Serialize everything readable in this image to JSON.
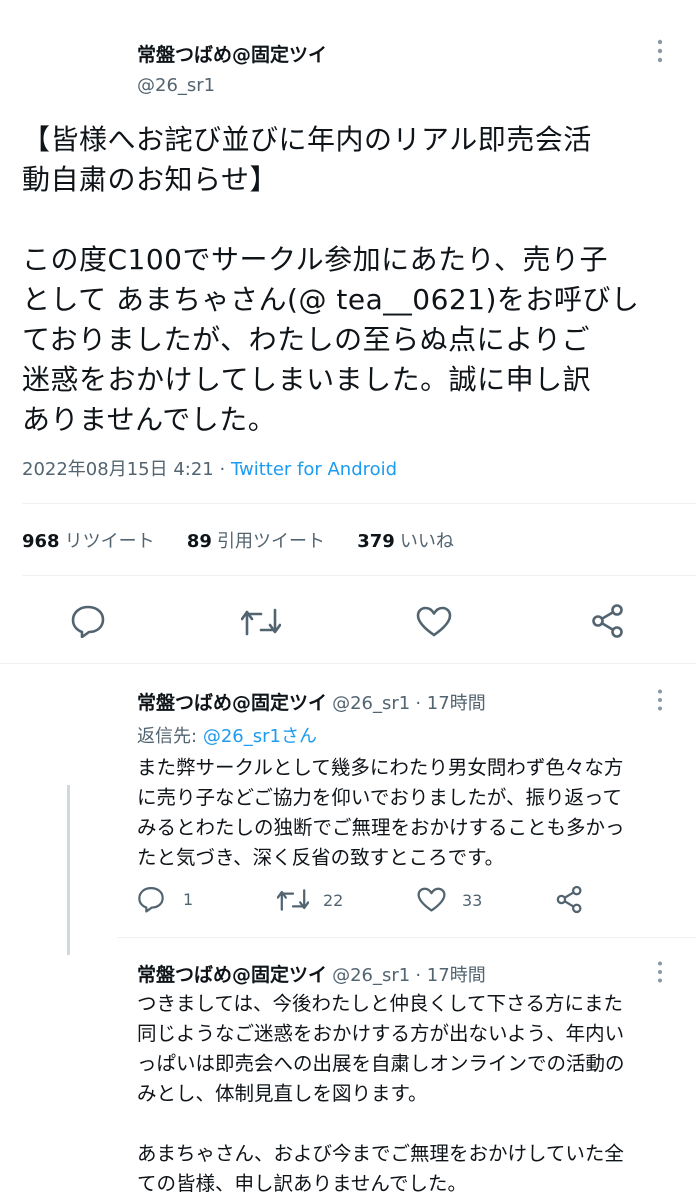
{
  "main_tweet": {
    "display_name": "常盤つばめ@固定ツイ",
    "handle": "@26_sr1",
    "text": "【皆様へお詫び並びに年内のリアル即売会活\n動自粛のお知らせ】\n\nこの度C100でサークル参加にあたり、売り子\nとして あまちゃさん(@ tea__0621)をお呼びし\nておりましたが、わたしの至らぬ点によりご\n迷惑をおかけしてしまいました。誠に申し訳\nありませんでした。",
    "timestamp": "2022年08月15日 4:21",
    "dot": "·",
    "source": "Twitter for Android",
    "stats": {
      "retweets_count": "968",
      "retweets_label": "リツイート",
      "quotes_count": "89",
      "quotes_label": "引用ツイート",
      "likes_count": "379",
      "likes_label": "いいね"
    },
    "actions": [
      "reply-icon",
      "retweet-icon",
      "like-icon",
      "share-icon"
    ]
  },
  "replies": [
    {
      "display_name": "常盤つばめ@固定ツイ",
      "handle": "@26_sr1",
      "time": "· 17時間",
      "reply_to_prefix": "返信先:",
      "reply_to_handle": "@26_sr1さん",
      "text": "また弊サークルとして幾多にわたり男女問わず色々な方\nに売り子などご協力を仰いでおりましたが、振り返って\nみるとわたしの独断でご無理をおかけすることも多かっ\nたと気づき、深く反省の致すところです。",
      "reply_count": "1",
      "retweet_count": "22",
      "like_count": "33"
    },
    {
      "display_name": "常盤つばめ@固定ツイ",
      "handle": "@26_sr1",
      "time": "· 17時間",
      "text": "つきましては、今後わたしと仲良くして下さる方にまた\n同じようなご迷惑をおかけする方が出ないよう、年内い\nっぱいは即売会への出展を自粛しオンラインでの活動の\nみとし、体制見直しを図ります。\n\nあまちゃさん、および今までご無理をおかけしていた全\nての皆様、申し訳ありませんでした。"
    }
  ],
  "colors": {
    "accent": "#1d9bf0",
    "muted": "#536471",
    "text": "#0f1419",
    "divider": "#eff3f4"
  }
}
